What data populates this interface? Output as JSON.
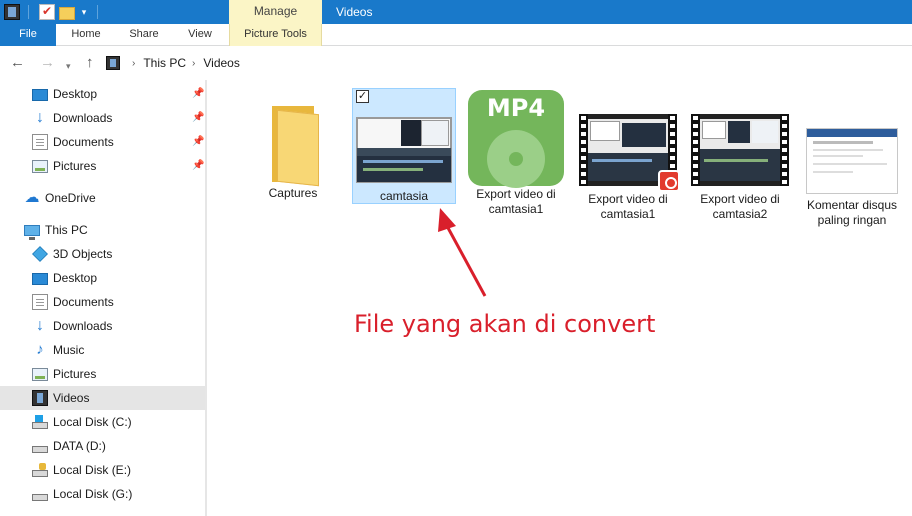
{
  "window": {
    "title": "Videos",
    "context_tab_group": "Manage"
  },
  "ribbon": {
    "tabs": [
      {
        "label": "File"
      },
      {
        "label": "Home"
      },
      {
        "label": "Share"
      },
      {
        "label": "View"
      },
      {
        "label": "Picture Tools"
      }
    ]
  },
  "address": {
    "breadcrumb": [
      "This PC",
      "Videos"
    ]
  },
  "sidebar": {
    "quick_access": [
      {
        "label": "Desktop",
        "icon": "desktop-icon",
        "pinned": true
      },
      {
        "label": "Downloads",
        "icon": "download-icon",
        "pinned": true
      },
      {
        "label": "Documents",
        "icon": "document-icon",
        "pinned": true
      },
      {
        "label": "Pictures",
        "icon": "pictures-icon",
        "pinned": true
      }
    ],
    "onedrive": {
      "label": "OneDrive",
      "icon": "cloud-icon"
    },
    "this_pc": {
      "label": "This PC",
      "icon": "computer-icon"
    },
    "pc_items": [
      {
        "label": "3D Objects",
        "icon": "cube-icon"
      },
      {
        "label": "Desktop",
        "icon": "desktop-icon"
      },
      {
        "label": "Documents",
        "icon": "document-icon"
      },
      {
        "label": "Downloads",
        "icon": "download-icon"
      },
      {
        "label": "Music",
        "icon": "music-icon"
      },
      {
        "label": "Pictures",
        "icon": "pictures-icon"
      },
      {
        "label": "Videos",
        "icon": "video-icon",
        "selected": true
      },
      {
        "label": "Local Disk (C:)",
        "icon": "windows-drive-icon"
      },
      {
        "label": "DATA (D:)",
        "icon": "drive-icon"
      },
      {
        "label": "Local Disk (E:)",
        "icon": "locked-drive-icon"
      },
      {
        "label": "Local Disk (G:)",
        "icon": "drive-icon"
      }
    ]
  },
  "files": [
    {
      "label": "Captures",
      "type": "folder"
    },
    {
      "label": "camtasia",
      "type": "screenshot",
      "selected": true,
      "checked": true
    },
    {
      "label": "Export video di camtasia1",
      "type": "mp4"
    },
    {
      "label": "Export video di camtasia1",
      "type": "video-badge"
    },
    {
      "label": "Export video di camtasia2",
      "type": "video"
    },
    {
      "label": "Komentar disqus paling ringan",
      "type": "image"
    }
  ],
  "annotation": {
    "text": "File yang akan di convert",
    "color": "#d91f2b"
  },
  "colors": {
    "titlebar": "#1979ca",
    "context_tab": "#fbf5c6",
    "selection": "#cce8ff"
  }
}
